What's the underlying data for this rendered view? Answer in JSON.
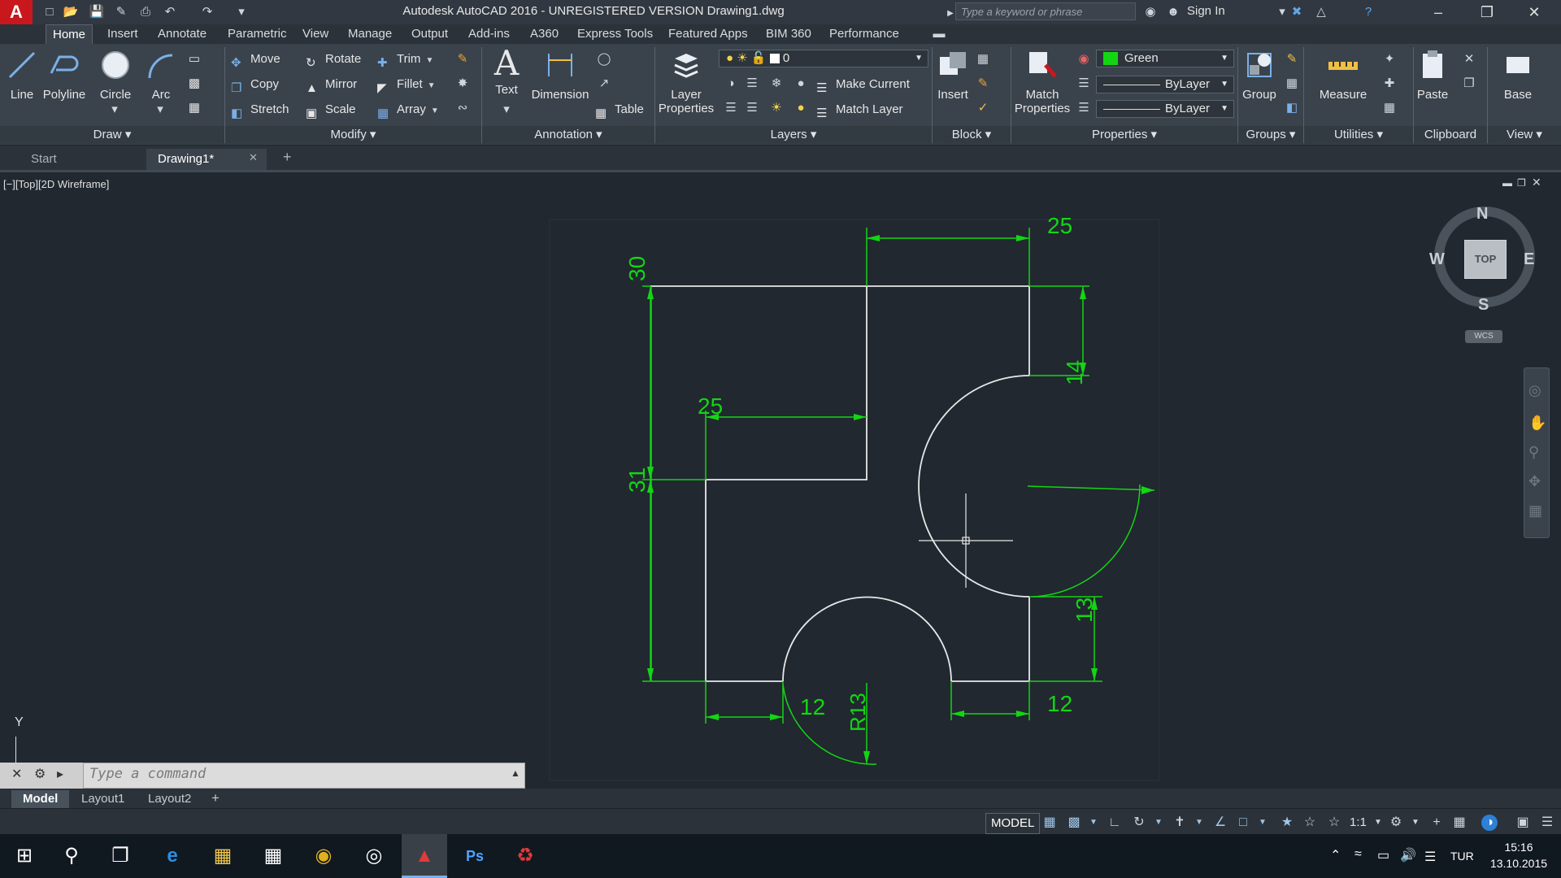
{
  "app": {
    "logo": "A",
    "window_title": "Autodesk AutoCAD 2016 - UNREGISTERED VERSION    Drawing1.dwg",
    "search_placeholder": "Type a keyword or phrase",
    "sign_in": "Sign In"
  },
  "ribbon_tabs": [
    "Home",
    "Insert",
    "Annotate",
    "Parametric",
    "View",
    "Manage",
    "Output",
    "Add-ins",
    "A360",
    "Express Tools",
    "Featured Apps",
    "BIM 360",
    "Performance"
  ],
  "draw": {
    "line": "Line",
    "polyline": "Polyline",
    "circle": "Circle",
    "arc": "Arc",
    "panel": "Draw"
  },
  "modify": {
    "move": "Move",
    "rotate": "Rotate",
    "trim": "Trim",
    "copy": "Copy",
    "mirror": "Mirror",
    "fillet": "Fillet",
    "stretch": "Stretch",
    "scale": "Scale",
    "array": "Array",
    "panel": "Modify"
  },
  "annotation": {
    "text": "Text",
    "dimension": "Dimension",
    "table": "Table",
    "panel": "Annotation"
  },
  "layers": {
    "layer_properties_1": "Layer",
    "layer_properties_2": "Properties",
    "current_layer": "0",
    "make_current": "Make Current",
    "match_layer": "Match Layer",
    "panel": "Layers"
  },
  "block": {
    "insert": "Insert",
    "panel": "Block"
  },
  "properties": {
    "match_1": "Match",
    "match_2": "Properties",
    "color": "Green",
    "color_hex": "#13d613",
    "linetype": "ByLayer",
    "lineweight": "ByLayer",
    "panel": "Properties"
  },
  "groups": {
    "group": "Group",
    "panel": "Groups"
  },
  "utilities": {
    "measure": "Measure",
    "panel": "Utilities"
  },
  "clipboard": {
    "paste": "Paste",
    "panel": "Clipboard"
  },
  "view_panel": {
    "base": "Base",
    "panel": "View"
  },
  "file_tabs": {
    "start": "Start",
    "drawing": "Drawing1*"
  },
  "viewport": {
    "label": "[−][Top][2D Wireframe]",
    "viewcube": {
      "n": "N",
      "s": "S",
      "e": "E",
      "w": "W",
      "top": "TOP",
      "wcs": "WCS"
    },
    "ucs_y": "Y"
  },
  "dimensions": {
    "d_top": "25",
    "d_left_top": "30",
    "d_inner": "25",
    "d_left_bottom": "31",
    "d_right_14": "14",
    "d_right_13": "13",
    "d_bottom_left": "12",
    "d_bottom_right": "12",
    "d_radius": "R13"
  },
  "command": {
    "placeholder": "Type a command"
  },
  "layout_tabs": [
    "Model",
    "Layout1",
    "Layout2"
  ],
  "status": {
    "model": "MODEL",
    "scale": "1:1"
  },
  "taskbar": {
    "lang": "TUR",
    "time": "15:16",
    "date": "13.10.2015"
  },
  "colors": {
    "dim_green": "#13d613",
    "geometry": "#e8e8e8",
    "background": "#212830"
  }
}
